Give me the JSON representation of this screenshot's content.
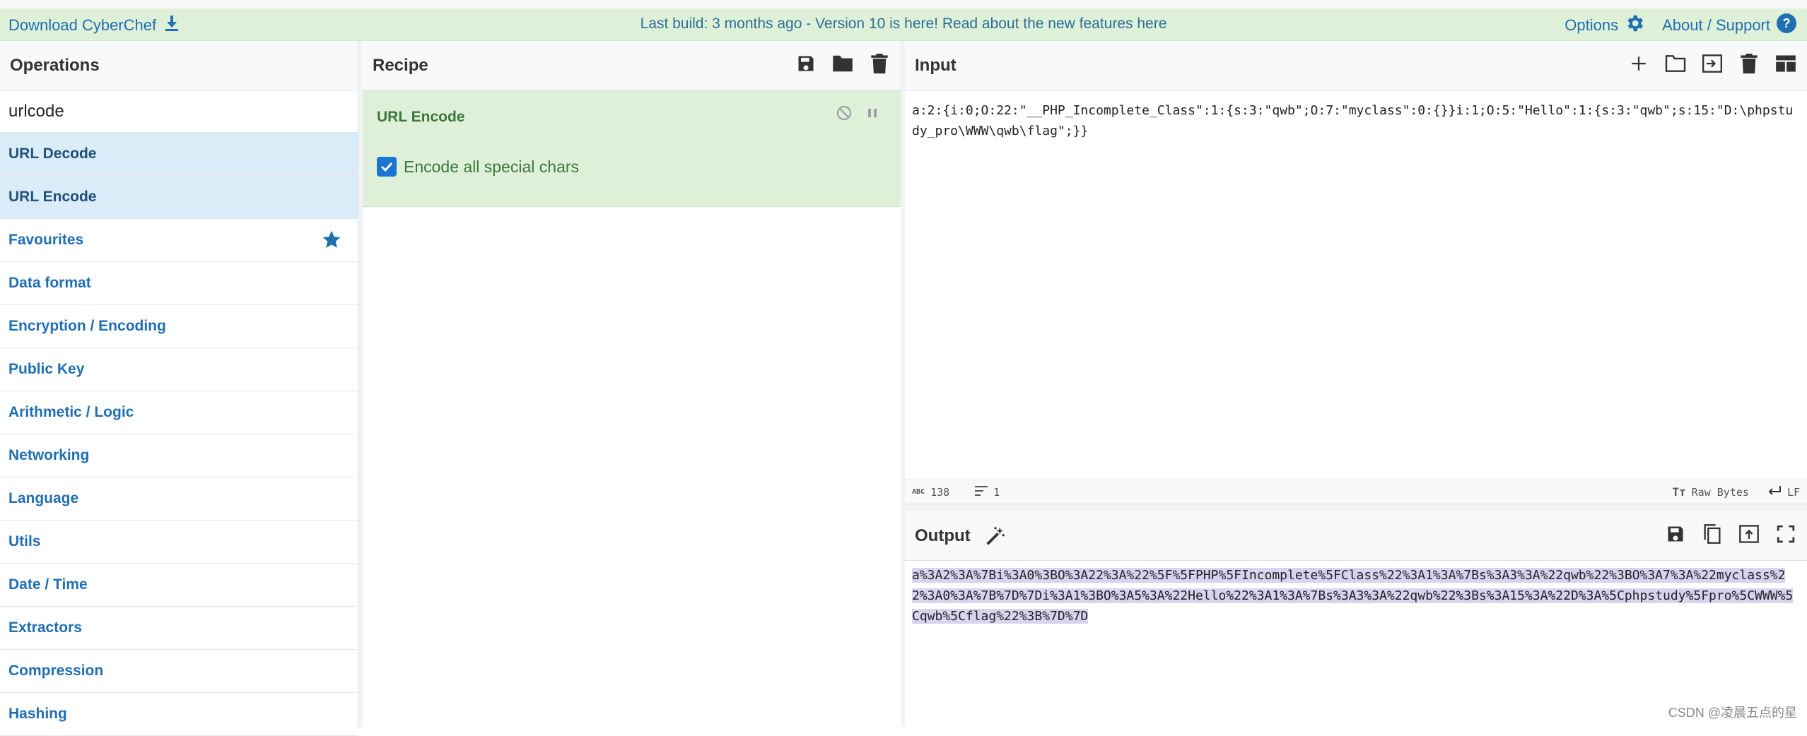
{
  "banner": {
    "download_label": "Download CyberChef",
    "build_message": "Last build: 3 months ago - Version 10 is here! Read about the new features here",
    "options_label": "Options",
    "about_label": "About / Support",
    "accent_color": "#1f6fb2",
    "background_color": "#dff0d8"
  },
  "operations": {
    "title": "Operations",
    "search_value": "urlcode",
    "results": [
      {
        "label_pre": "URL De",
        "label_hl": "code"
      },
      {
        "label_pre": "URL En",
        "label_hl": "code"
      }
    ],
    "categories": [
      "Favourites",
      "Data format",
      "Encryption / Encoding",
      "Public Key",
      "Arithmetic / Logic",
      "Networking",
      "Language",
      "Utils",
      "Date / Time",
      "Extractors",
      "Compression",
      "Hashing"
    ]
  },
  "recipe": {
    "title": "Recipe",
    "operation_name": "URL Encode",
    "option_label": "Encode all special chars",
    "option_checked": true
  },
  "input": {
    "title": "Input",
    "text": "a:2:{i:0;O:22:\"__PHP_Incomplete_Class\":1:{s:3:\"qwb\";O:7:\"myclass\":0:{}}i:1;O:5:\"Hello\":1:{s:3:\"qwb\";s:15:\"D:\\phpstudy_pro\\WWW\\qwb\\flag\";}}",
    "char_count": "138",
    "line_count": "1",
    "encoding": "Raw Bytes",
    "eol": "LF"
  },
  "output": {
    "title": "Output",
    "text": "a%3A2%3A%7Bi%3A0%3BO%3A22%3A%22%5F%5FPHP%5FIncomplete%5FClass%22%3A1%3A%7Bs%3A3%3A%22qwb%22%3BO%3A7%3A%22myclass%22%3A0%3A%7B%7D%7Di%3A1%3BO%3A5%3A%22Hello%22%3A1%3A%7Bs%3A3%3A%22qwb%22%3Bs%3A15%3A%22D%3A%5Cphpstudy%5Fpro%5CWWW%5Cqwb%5Cflag%22%3B%7D%7D"
  },
  "watermark": "CSDN @凌晨五点的星"
}
